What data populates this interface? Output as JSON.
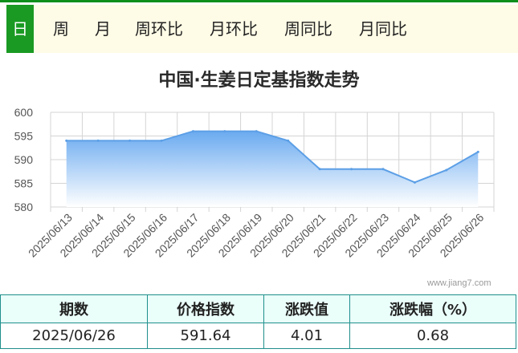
{
  "tabs": [
    {
      "label": "日",
      "active": true
    },
    {
      "label": "周",
      "active": false
    },
    {
      "label": "月",
      "active": false
    },
    {
      "label": "周环比",
      "active": false
    },
    {
      "label": "月环比",
      "active": false
    },
    {
      "label": "周同比",
      "active": false
    },
    {
      "label": "月同比",
      "active": false
    }
  ],
  "chart_data": {
    "type": "area",
    "title": "中国·生姜日定基指数走势",
    "categories": [
      "2025/06/13",
      "2025/06/14",
      "2025/06/15",
      "2025/06/16",
      "2025/06/17",
      "2025/06/18",
      "2025/06/19",
      "2025/06/20",
      "2025/06/21",
      "2025/06/22",
      "2025/06/23",
      "2025/06/24",
      "2025/06/25",
      "2025/06/26"
    ],
    "values": [
      594,
      594,
      594,
      594,
      596,
      596,
      596,
      594,
      588,
      588,
      588,
      585.2,
      587.8,
      591.64
    ],
    "ylim": [
      580,
      600
    ],
    "yticks": [
      580,
      585,
      590,
      595,
      600
    ],
    "grid": true,
    "colors": {
      "fill_top": "#6aaaf0",
      "fill_bottom": "#ffffff",
      "line": "#5c9fe6"
    }
  },
  "watermark": "www.jiang7.com",
  "table": {
    "headers": [
      "期数",
      "价格指数",
      "涨跌值",
      "涨跌幅（%）"
    ],
    "row": [
      "2025/06/26",
      "591.64",
      "4.01",
      "0.68"
    ]
  }
}
